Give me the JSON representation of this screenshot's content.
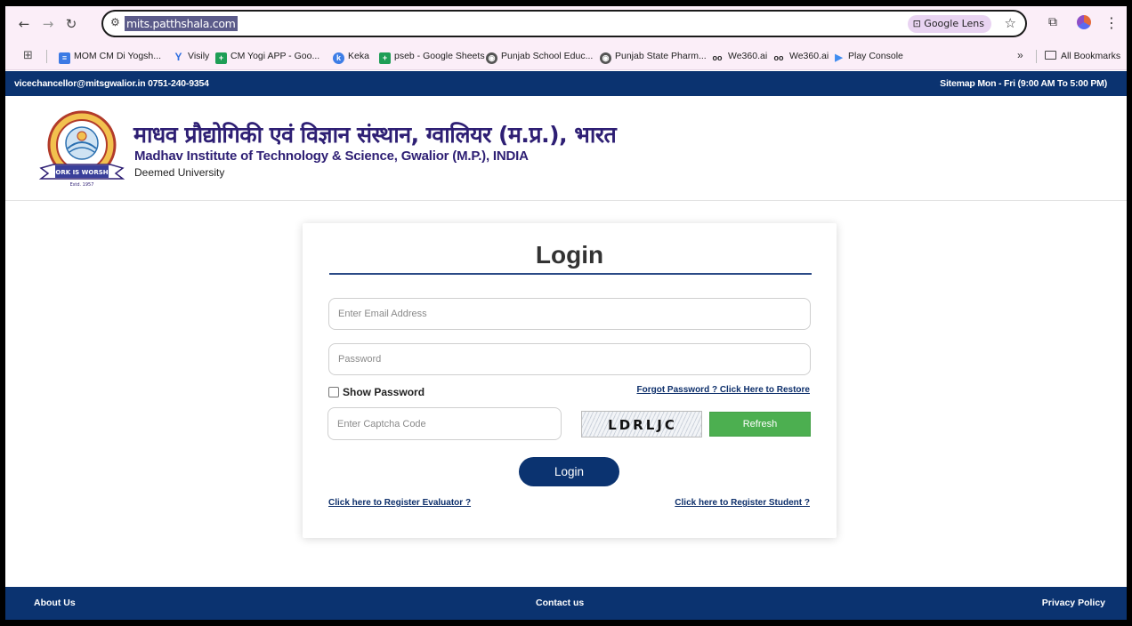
{
  "browser": {
    "url": "mits.patthshala.com",
    "lens_label": "Google Lens",
    "bookmarks": [
      {
        "label": "MOM CM Di Yogsh...",
        "icon": "docs-icon",
        "color": "#3c7ae4"
      },
      {
        "label": "Visily",
        "icon": "visily-icon",
        "color": "#2f6fe0"
      },
      {
        "label": "CM Yogi APP - Goo...",
        "icon": "sheets-icon",
        "color": "#1e9e56"
      },
      {
        "label": "Keka",
        "icon": "keka-icon",
        "color": "#3d7de6"
      },
      {
        "label": "pseb - Google Sheets",
        "icon": "sheets-icon",
        "color": "#1e9e56"
      },
      {
        "label": "Punjab School Educ...",
        "icon": "globe-icon",
        "color": "#555555"
      },
      {
        "label": "Punjab State Pharm...",
        "icon": "globe-icon",
        "color": "#555555"
      },
      {
        "label": "We360.ai",
        "icon": "we360-icon",
        "color": "#222222"
      },
      {
        "label": "We360.ai",
        "icon": "we360-icon",
        "color": "#222222"
      },
      {
        "label": "Play Console",
        "icon": "play-console-icon",
        "color": "#3f8cf0"
      }
    ],
    "more_label": "»",
    "all_bookmarks_label": "All Bookmarks"
  },
  "topbar": {
    "contact": "vicechancellor@mitsgwalior.in   0751-240-9354",
    "hours": "Sitemap   Mon - Fri (9:00 AM To 5:00 PM)"
  },
  "header": {
    "title_hindi": "माधव प्रौद्योगिकी एवं विज्ञान संस्थान, ग्वालियर (म.प्र.), भारत",
    "title_english": "Madhav Institute of Technology & Science, Gwalior (M.P.), INDIA",
    "subtitle": "Deemed University",
    "logo_motto": "WORK IS WORSHIP",
    "logo_year": "Estd. 1957"
  },
  "login": {
    "title": "Login",
    "email_placeholder": "Enter Email Address",
    "password_placeholder": "Password",
    "show_password_label": "Show Password",
    "forgot_link": "Forgot Password ? Click Here to Restore",
    "captcha_placeholder": "Enter Captcha Code",
    "captcha_text": "LDRLJC",
    "refresh_label": "Refresh",
    "login_button": "Login",
    "register_evaluator": "Click here to Register Evaluator ?",
    "register_student": "Click here to Register Student ?"
  },
  "footer": {
    "about": "About Us",
    "contact": "Contact us",
    "privacy": "Privacy Policy"
  },
  "colors": {
    "brand_navy": "#0b3370",
    "title_purple": "#2e1f74",
    "refresh_green": "#4caf50"
  }
}
